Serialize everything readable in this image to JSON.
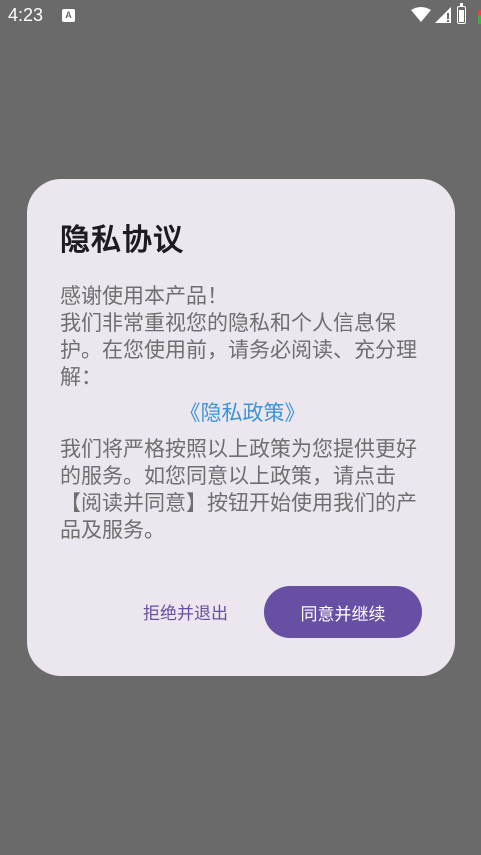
{
  "status_bar": {
    "time": "4:23",
    "notification_icon": "A"
  },
  "dialog": {
    "title": "隐私协议",
    "intro_line1": "感谢使用本产品！",
    "intro_line2": "我们非常重视您的隐私和个人信息保护。在您使用前，请务必阅读、充分理解：",
    "policy_link": "《隐私政策》",
    "outro": "我们将严格按照以上政策为您提供更好的服务。如您同意以上政策，请点击【阅读并同意】按钮开始使用我们的产品及服务。",
    "reject_label": "拒绝并退出",
    "agree_label": "同意并继续"
  },
  "colors": {
    "scrim": "#6a6a6a",
    "dialog_bg": "#ece6ef",
    "accent": "#6750a4",
    "link": "#3c95d6"
  }
}
